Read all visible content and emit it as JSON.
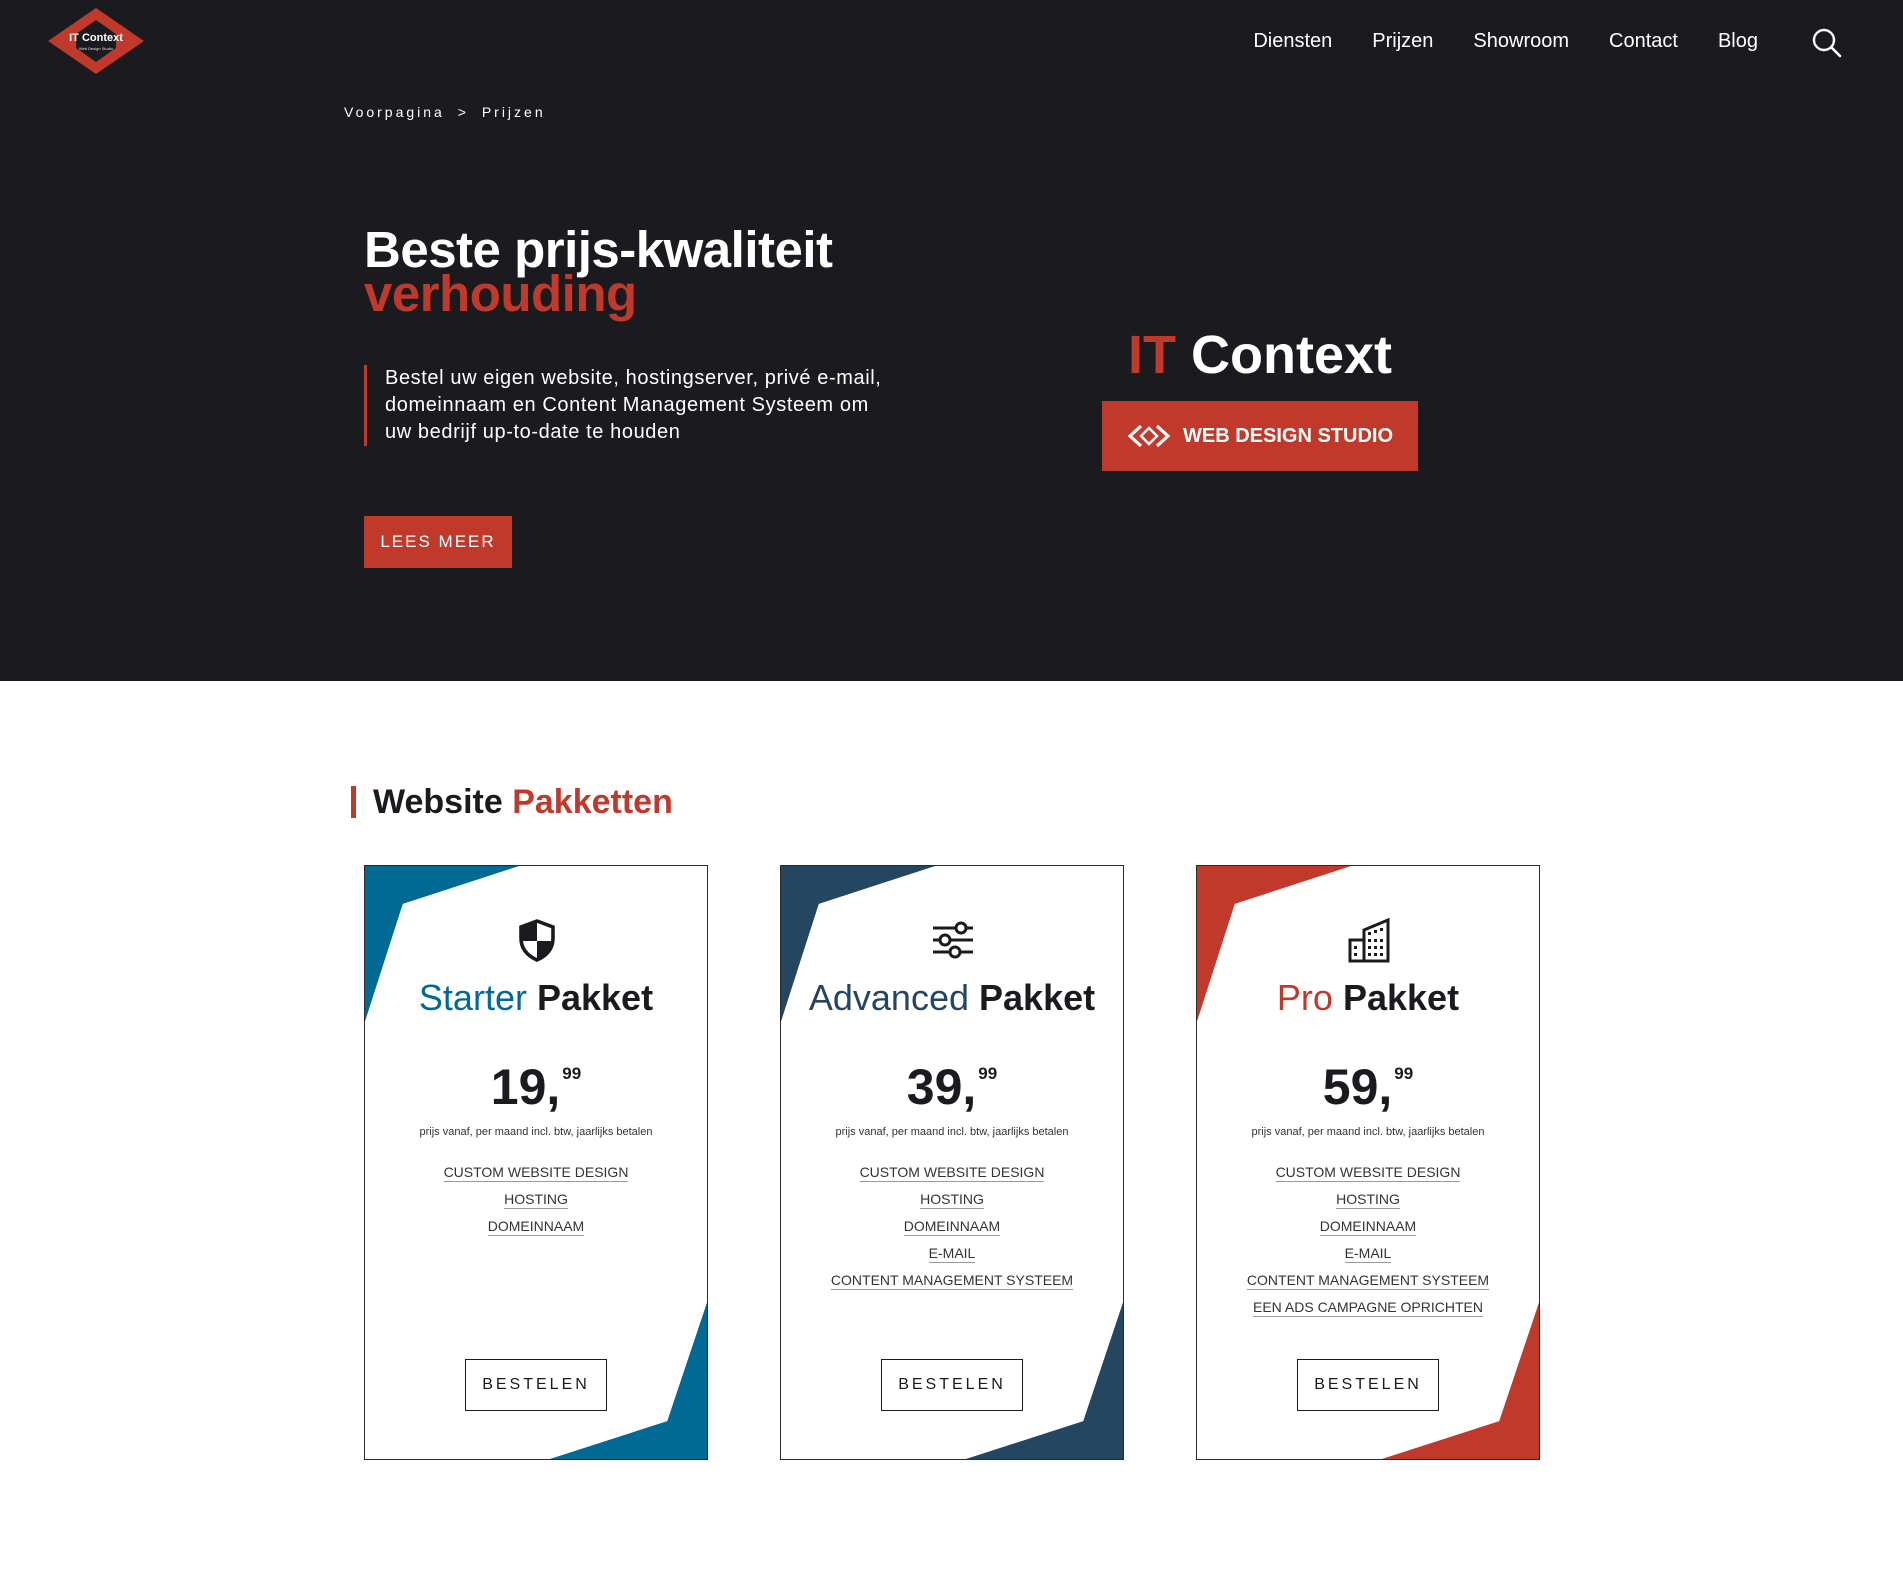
{
  "colors": {
    "dark_background": "#1b1b1f",
    "accent_red": "#c0392b",
    "starter_blue": "#006a94",
    "advanced_navy": "#244660"
  },
  "logo": {
    "text": "IT Context",
    "subtitle": "Web Design Studio"
  },
  "nav": {
    "items": [
      {
        "label": "Diensten"
      },
      {
        "label": "Prijzen"
      },
      {
        "label": "Showroom"
      },
      {
        "label": "Contact"
      },
      {
        "label": "Blog"
      }
    ],
    "search_icon": "search-icon"
  },
  "breadcrumb": {
    "home": "Voorpagina",
    "separator": ">",
    "current": "Prijzen"
  },
  "hero": {
    "title_line1": "Beste prijs-kwaliteit",
    "title_line2": "verhouding",
    "description": "Bestel uw eigen website, hostingserver, privé e-mail, domeinnaam en Content Management Systeem om uw bedrijf up-to-date te houden",
    "cta_label": "LEES MEER"
  },
  "brand": {
    "prefix": "IT",
    "name": "Context",
    "button_label": "WEB DESIGN STUDIO",
    "button_icon": "code-brackets-icon"
  },
  "section": {
    "title_part1": "Website",
    "title_part2": "Pakketten"
  },
  "packages": [
    {
      "icon": "shield-icon",
      "name": "Starter",
      "suffix": "Pakket",
      "color": "#006a94",
      "price": "19,",
      "cents": "99",
      "note": "prijs vanaf, per maand incl. btw, jaarlijks betalen",
      "features": [
        "CUSTOM WEBSITE DESIGN",
        "HOSTING",
        "DOMEINNAAM"
      ],
      "button": "BESTELEN"
    },
    {
      "icon": "sliders-icon",
      "name": "Advanced",
      "suffix": "Pakket",
      "color": "#244660",
      "price": "39,",
      "cents": "99",
      "note": "prijs vanaf, per maand incl. btw, jaarlijks betalen",
      "features": [
        "CUSTOM WEBSITE DESIGN",
        "HOSTING",
        "DOMEINNAAM",
        "E-MAIL",
        "CONTENT MANAGEMENT SYSTEEM"
      ],
      "button": "BESTELEN"
    },
    {
      "icon": "building-icon",
      "name": "Pro",
      "suffix": "Pakket",
      "color": "#c0392b",
      "price": "59,",
      "cents": "99",
      "note": "prijs vanaf, per maand incl. btw, jaarlijks betalen",
      "features": [
        "CUSTOM WEBSITE DESIGN",
        "HOSTING",
        "DOMEINNAAM",
        "E-MAIL",
        "CONTENT MANAGEMENT SYSTEEM",
        "EEN ADS CAMPAGNE OPRICHTEN"
      ],
      "button": "BESTELEN"
    }
  ]
}
